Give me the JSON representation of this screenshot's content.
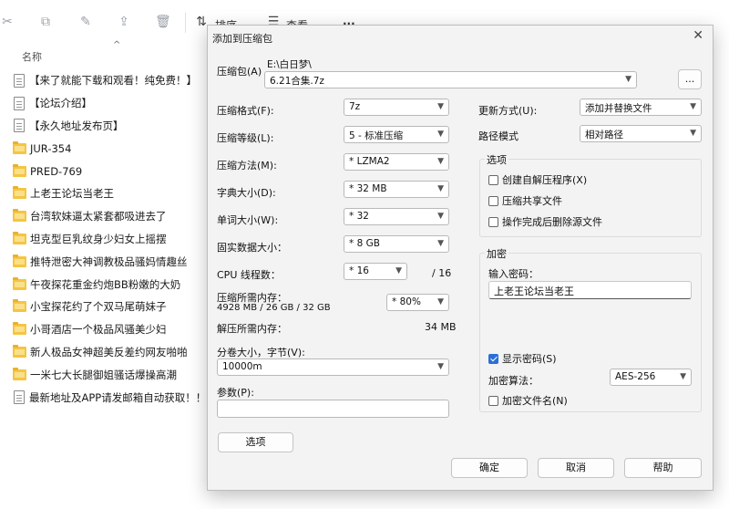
{
  "explorer": {
    "toolbar": {
      "sort_label": "排序",
      "view_label": "查看",
      "more_label": "···"
    },
    "column_header": "名称",
    "files": [
      {
        "type": "doc",
        "name": "【来了就能下载和观看！纯免费！】"
      },
      {
        "type": "doc",
        "name": "【论坛介绍】"
      },
      {
        "type": "doc",
        "name": "【永久地址发布页】"
      },
      {
        "type": "folder",
        "name": "JUR-354"
      },
      {
        "type": "folder",
        "name": "PRED-769"
      },
      {
        "type": "folder",
        "name": "上老王论坛当老王"
      },
      {
        "type": "folder",
        "name": "台湾软妹逼太紧套都吸进去了"
      },
      {
        "type": "folder",
        "name": "坦克型巨乳纹身少妇女上摇摆"
      },
      {
        "type": "folder",
        "name": "推特泄密大神调教极品骚妈情趣丝"
      },
      {
        "type": "folder",
        "name": "午夜探花重金约炮BB粉嫩的大奶"
      },
      {
        "type": "folder",
        "name": "小宝探花约了个双马尾萌妹子"
      },
      {
        "type": "folder",
        "name": "小哥酒店一个极品风骚美少妇"
      },
      {
        "type": "folder",
        "name": "新人极品女神超美反差约网友啪啪"
      },
      {
        "type": "folder",
        "name": "一米七大长腿御姐骚话爆操高潮"
      },
      {
        "type": "doc",
        "name": "最新地址及APP请发邮箱自动获取！！！"
      }
    ]
  },
  "dialog": {
    "title": "添加到压缩包",
    "close_glyph": "✕",
    "archive_label": "压缩包(A)",
    "archive_path": "E:\\白日梦\\",
    "archive_name": "6.21合集.7z",
    "browse_label": "...",
    "left": {
      "format_label": "压缩格式(F):",
      "format_value": "7z",
      "level_label": "压缩等级(L):",
      "level_value": "5 - 标准压缩",
      "method_label": "压缩方法(M):",
      "method_value": "*  LZMA2",
      "dict_label": "字典大小(D):",
      "dict_value": "*  32 MB",
      "word_label": "单词大小(W):",
      "word_value": "*  32",
      "solid_label": "固实数据大小：",
      "solid_value": "*  8 GB",
      "threads_label": "CPU 线程数：",
      "threads_value": "*  16",
      "threads_max": "/ 16",
      "mem_comp_label": "压缩所需内存：",
      "mem_comp_detail": "4928 MB / 26 GB / 32 GB",
      "mem_comp_value": "*  80%",
      "mem_decomp_label": "解压所需内存：",
      "mem_decomp_value": "34 MB",
      "split_label": "分卷大小，字节(V):",
      "split_value": "10000m",
      "params_label": "参数(P):",
      "params_value": "",
      "options_button": "选项"
    },
    "right": {
      "update_label": "更新方式(U):",
      "update_value": "添加并替换文件",
      "path_label": "路径模式",
      "path_value": "相对路径",
      "options_group": "选项",
      "opt_sfx": "创建自解压程序(X)",
      "opt_shared": "压缩共享文件",
      "opt_delete": "操作完成后删除源文件",
      "encrypt_group": "加密",
      "password_label": "输入密码：",
      "password_value": "上老王论坛当老王",
      "show_password": "显示密码(S)",
      "enc_method_label": "加密算法：",
      "enc_method_value": "AES-256",
      "enc_names": "加密文件名(N)"
    },
    "buttons": {
      "ok": "确定",
      "cancel": "取消",
      "help": "帮助"
    }
  }
}
